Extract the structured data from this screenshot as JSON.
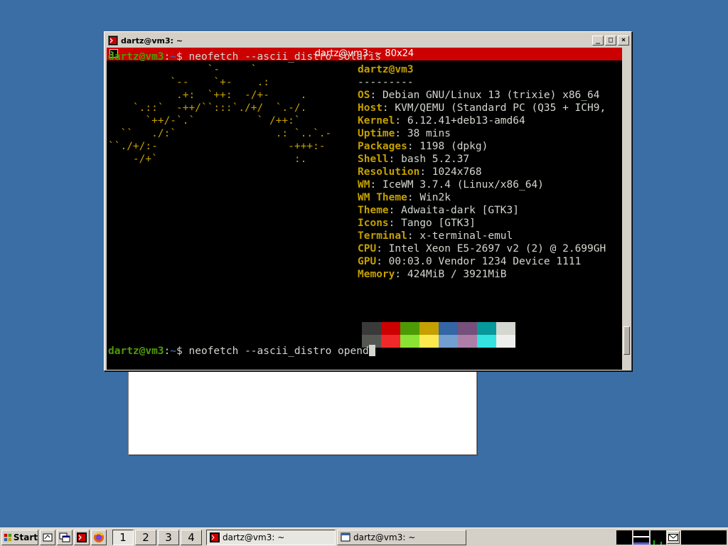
{
  "window": {
    "title": "dartz@vm3: ~",
    "terminal_title": "dartz@vm3: ~ 80x24",
    "buttons": {
      "minimize": "_",
      "maximize": "□",
      "close": "×"
    }
  },
  "terminal": {
    "prompt_user": "dartz@vm3",
    "prompt_sep": ":",
    "prompt_path": "~",
    "prompt_end": "$",
    "command1": " neofetch --ascii_distro solaris",
    "command2": " neofetch --ascii_distro opend",
    "ascii_art": [
      "                `-     `",
      "          `--    `+-    .:",
      "           .+:  `++:  -/+-     .",
      "    `.::`  -++/``:::`./+/  `.-/.",
      "      `++/-`.`          ` /++:`",
      "  ``   ./:`                .: `..`.-",
      "``./+/:-                     -+++:-",
      "    -/+`                      :."
    ],
    "info_header": "dartz@vm3",
    "info_divider": "---------",
    "info": [
      {
        "key": "OS",
        "value": "Debian GNU/Linux 13 (trixie) x86_64"
      },
      {
        "key": "Host",
        "value": "KVM/QEMU (Standard PC (Q35 + ICH9,"
      },
      {
        "key": "Kernel",
        "value": "6.12.41+deb13-amd64"
      },
      {
        "key": "Uptime",
        "value": "38 mins"
      },
      {
        "key": "Packages",
        "value": "1198 (dpkg)"
      },
      {
        "key": "Shell",
        "value": "bash 5.2.37"
      },
      {
        "key": "Resolution",
        "value": "1024x768"
      },
      {
        "key": "WM",
        "value": "IceWM 3.7.4 (Linux/x86_64)"
      },
      {
        "key": "WM Theme",
        "value": "Win2k"
      },
      {
        "key": "Theme",
        "value": "Adwaita-dark [GTK3]"
      },
      {
        "key": "Icons",
        "value": "Tango [GTK3]"
      },
      {
        "key": "Terminal",
        "value": "x-terminal-emul"
      },
      {
        "key": "CPU",
        "value": "Intel Xeon E5-2697 v2 (2) @ 2.699GH"
      },
      {
        "key": "GPU",
        "value": "00:03.0 Vendor 1234 Device 1111"
      },
      {
        "key": "Memory",
        "value": "424MiB / 3921MiB"
      }
    ],
    "palette": [
      "#3a3a3a",
      "#cc0000",
      "#4e9a06",
      "#c4a000",
      "#3465a4",
      "#75507b",
      "#06989a",
      "#d3d7cf",
      "#555753",
      "#ef2929",
      "#8ae234",
      "#fce94f",
      "#729fcf",
      "#ad7fa8",
      "#34e2e2",
      "#eeeeec"
    ]
  },
  "taskbar": {
    "start_label": "Start",
    "workspaces": [
      "1",
      "2",
      "3",
      "4"
    ],
    "tasks": [
      "dartz@vm3: ~",
      "dartz@vm3: ~"
    ]
  }
}
